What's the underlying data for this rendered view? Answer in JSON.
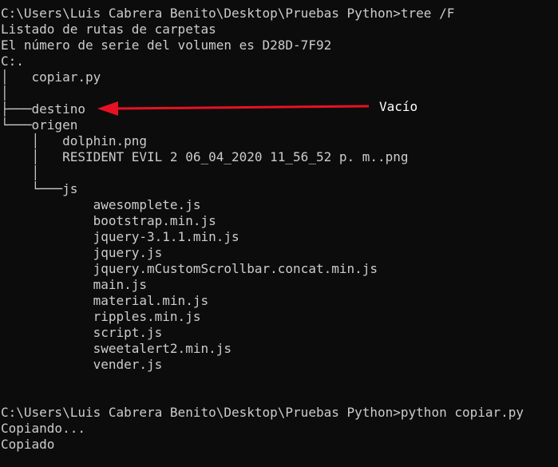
{
  "terminal": {
    "text_color": "#cccccc",
    "background": "#0c0c0c",
    "lines": [
      "C:\\Users\\Luis Cabrera Benito\\Desktop\\Pruebas Python>tree /F",
      "Listado de rutas de carpetas",
      "El número de serie del volumen es D28D-7F92",
      "C:.",
      "│   copiar.py",
      "│",
      "├───destino",
      "└───origen",
      "    │   dolphin.png",
      "    │   RESIDENT EVIL 2 06_04_2020 11_56_52 p. m..png",
      "    │",
      "    └───js",
      "            awesomplete.js",
      "            bootstrap.min.js",
      "            jquery-3.1.1.min.js",
      "            jquery.js",
      "            jquery.mCustomScrollbar.concat.min.js",
      "            main.js",
      "            material.min.js",
      "            ripples.min.js",
      "            script.js",
      "            sweetalert2.min.js",
      "            vender.js",
      "",
      "",
      "C:\\Users\\Luis Cabrera Benito\\Desktop\\Pruebas Python>python copiar.py",
      "Copiando...",
      "Copiado"
    ]
  },
  "annotation": {
    "label": "Vacío",
    "arrow_color": "#e81123",
    "label_color": "#ffffff"
  }
}
